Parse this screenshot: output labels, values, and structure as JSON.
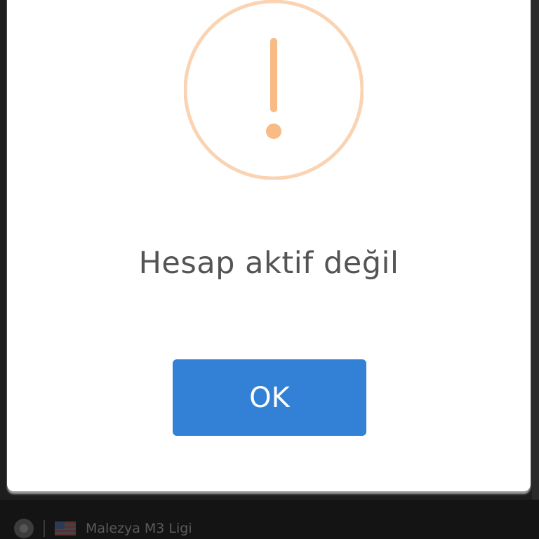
{
  "dialog": {
    "title": "Hesap aktif değil",
    "confirm_label": "OK",
    "icon": "warning-icon",
    "icon_color": "#f8bb86",
    "button_color": "#3281d6"
  },
  "background": {
    "league_label": "Malezya M3 Ligi",
    "sport_icon": "soccer-ball-icon",
    "flag_icon": "malaysia-flag-icon"
  }
}
